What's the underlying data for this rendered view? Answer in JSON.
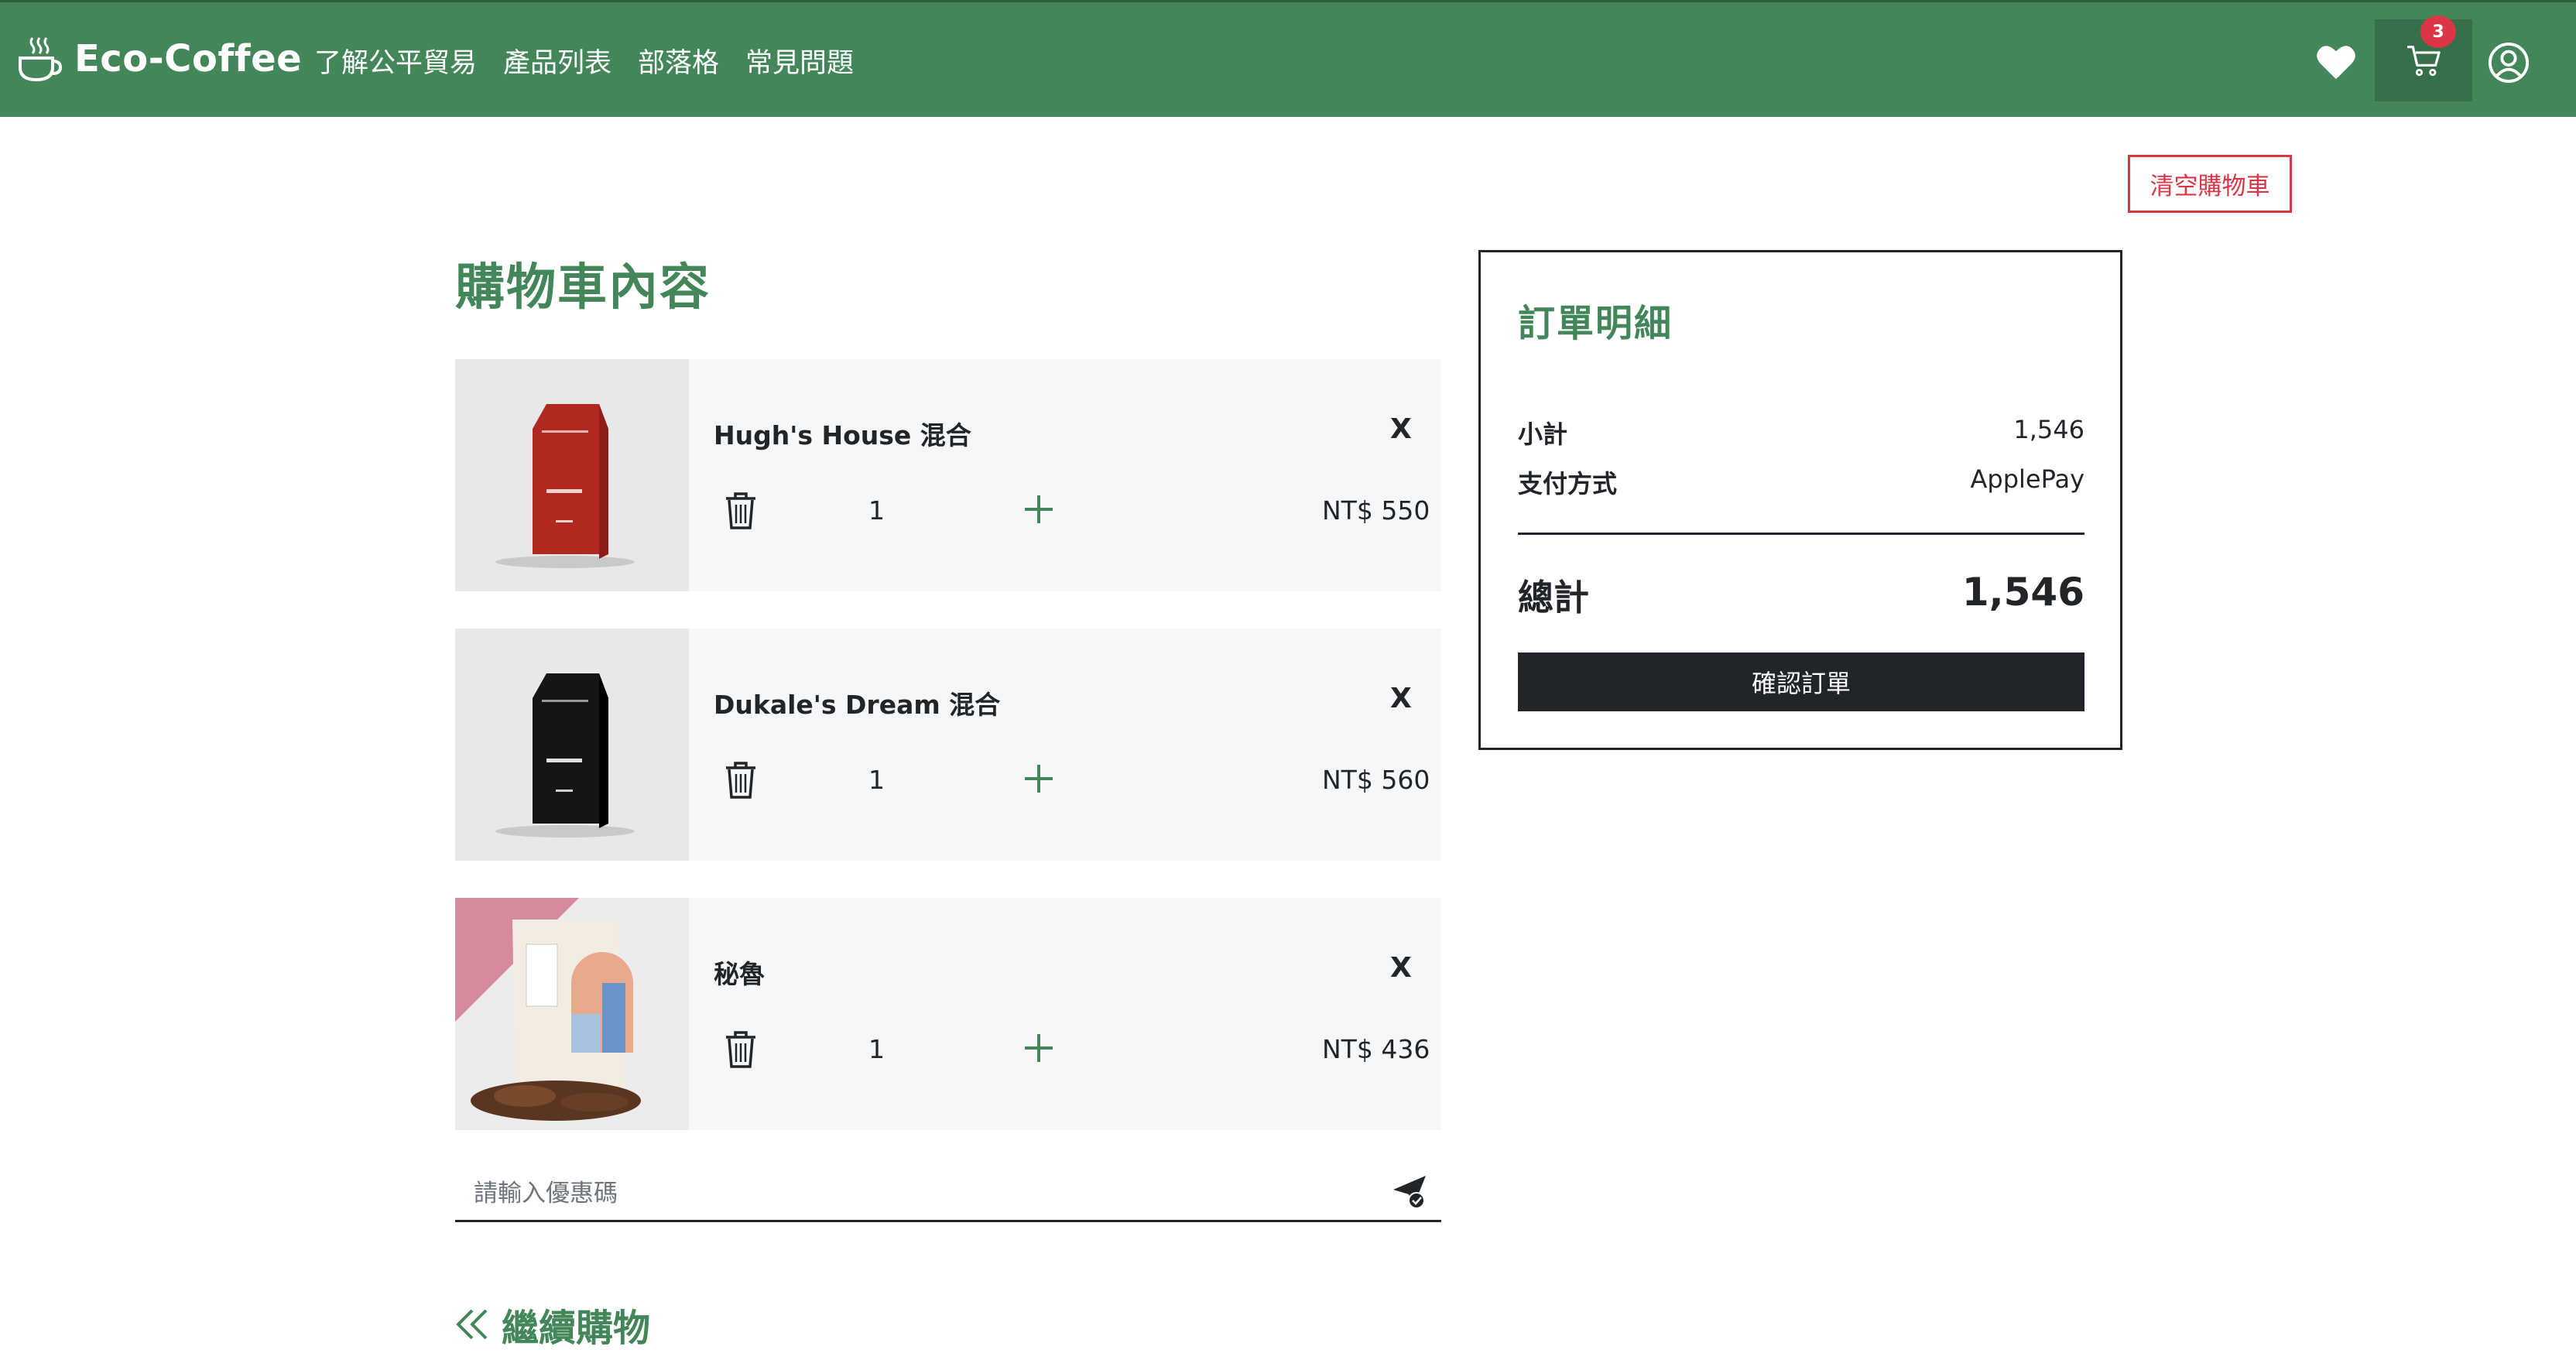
{
  "brand": {
    "name": "Eco-Coffee",
    "icon": "coffee-cup-icon"
  },
  "nav": {
    "links": [
      "了解公平貿易",
      "產品列表",
      "部落格",
      "常見問題"
    ],
    "icons": [
      "heart-icon",
      "cart-icon",
      "user-circle-icon"
    ],
    "cart_count": "3"
  },
  "colors": {
    "brand_green": "#438659",
    "danger": "#dc3545",
    "dark": "#212529",
    "item_bg": "#f6f7f8"
  },
  "clear_cart_label": "清空購物車",
  "cart": {
    "title": "購物車內容",
    "remove_label": "X",
    "items": [
      {
        "name": "Hugh's House 混合",
        "qty": "1",
        "price": "NT$ 550",
        "image": "red-coffee-bag"
      },
      {
        "name": "Dukale's Dream 混合",
        "qty": "1",
        "price": "NT$ 560",
        "image": "black-coffee-bag"
      },
      {
        "name": "秘魯",
        "qty": "1",
        "price": "NT$ 436",
        "image": "white-coffee-bag-with-beans"
      }
    ]
  },
  "coupon": {
    "placeholder": "請輸入優惠碼",
    "value": ""
  },
  "continue_label": "繼續購物",
  "summary": {
    "title": "訂單明細",
    "subtotal_label": "小計",
    "subtotal_value": "1,546",
    "payment_label": "支付方式",
    "payment_value": "ApplePay",
    "total_label": "總計",
    "total_value": "1,546",
    "confirm_label": "確認訂單"
  }
}
